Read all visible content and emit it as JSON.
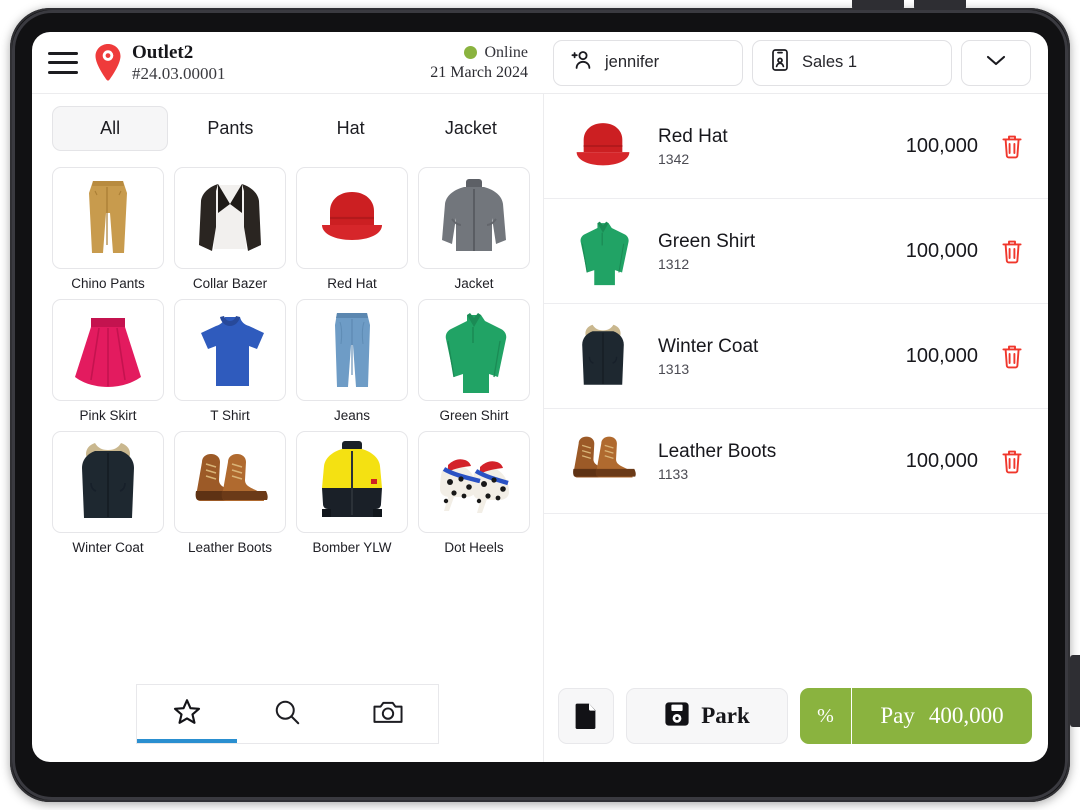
{
  "colors": {
    "accent_green": "#8ab33f",
    "pin_red": "#ef3b3b",
    "delete_red": "#f0372c",
    "nav_underline_blue": "#2a8fd0"
  },
  "header": {
    "menu_icon": "hamburger-menu-icon",
    "location_icon": "location-pin-icon",
    "outlet_name": "Outlet2",
    "outlet_code": "#24.03.00001",
    "status_label": "Online",
    "date": "21 March 2024",
    "customer": {
      "icon": "add-person-icon",
      "label": "jennifer"
    },
    "salesperson": {
      "icon": "id-card-icon",
      "label": "Sales 1"
    },
    "dropdown": {
      "icon": "chevron-down-icon"
    }
  },
  "catalog": {
    "tabs": [
      {
        "label": "All",
        "active": true
      },
      {
        "label": "Pants",
        "active": false
      },
      {
        "label": "Hat",
        "active": false
      },
      {
        "label": "Jacket",
        "active": false
      }
    ],
    "products": [
      {
        "label": "Chino Pants",
        "art": "chino-pants"
      },
      {
        "label": "Collar Bazer",
        "art": "collar-blazer"
      },
      {
        "label": "Red Hat",
        "art": "red-hat"
      },
      {
        "label": "Jacket",
        "art": "grey-jacket"
      },
      {
        "label": "Pink Skirt",
        "art": "pink-skirt"
      },
      {
        "label": "T Shirt",
        "art": "blue-tshirt"
      },
      {
        "label": "Jeans",
        "art": "jeans"
      },
      {
        "label": "Green Shirt",
        "art": "green-shirt"
      },
      {
        "label": "Winter Coat",
        "art": "winter-coat"
      },
      {
        "label": "Leather Boots",
        "art": "leather-boots"
      },
      {
        "label": "Bomber YLW",
        "art": "bomber-jacket"
      },
      {
        "label": "Dot Heels",
        "art": "dot-heels"
      }
    ],
    "bottom_nav": [
      {
        "icon": "star-icon",
        "active": true
      },
      {
        "icon": "search-icon",
        "active": false
      },
      {
        "icon": "camera-icon",
        "active": false
      }
    ]
  },
  "cart": {
    "items": [
      {
        "name": "Red Hat",
        "code": "1342",
        "price": "100,000",
        "art": "red-hat",
        "delete_icon": "trash-icon"
      },
      {
        "name": "Green Shirt",
        "code": "1312",
        "price": "100,000",
        "art": "green-shirt",
        "delete_icon": "trash-icon"
      },
      {
        "name": "Winter Coat",
        "code": "1313",
        "price": "100,000",
        "art": "winter-coat",
        "delete_icon": "trash-icon"
      },
      {
        "name": "Leather Boots",
        "code": "1133",
        "price": "100,000",
        "art": "leather-boots",
        "delete_icon": "trash-icon"
      }
    ],
    "actions": {
      "note_icon": "document-icon",
      "park_icon": "save-floppy-icon",
      "park_label": "Park",
      "discount_label": "%",
      "pay_label": "Pay",
      "pay_total": "400,000"
    }
  }
}
